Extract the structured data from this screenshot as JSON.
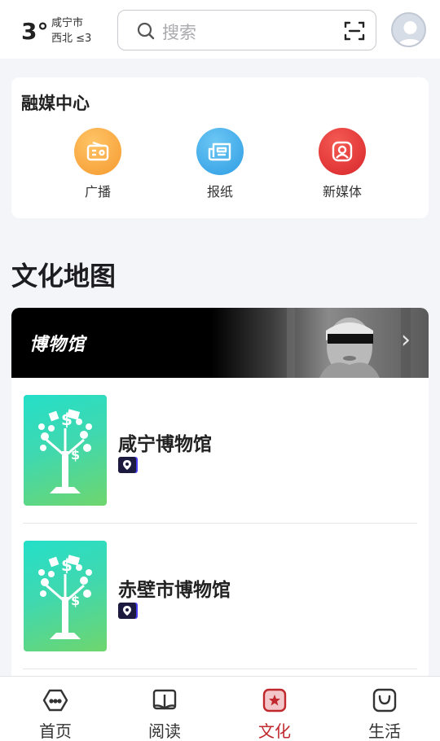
{
  "weather": {
    "temperature": "3°",
    "city": "咸宁市",
    "wind": "西北 ≤3"
  },
  "search": {
    "placeholder": "搜索"
  },
  "media_center": {
    "title": "融媒中心",
    "items": [
      {
        "label": "广播",
        "icon": "radio-icon",
        "color": "#f7a33a"
      },
      {
        "label": "报纸",
        "icon": "newspaper-icon",
        "color": "#3fa8ea"
      },
      {
        "label": "新媒体",
        "icon": "new-media-icon",
        "color": "#e33a3a"
      }
    ]
  },
  "culture_map": {
    "title": "文化地图",
    "banner_title": "博物馆",
    "museums": [
      {
        "name": "咸宁博物馆"
      },
      {
        "name": "赤壁市博物馆"
      }
    ]
  },
  "bottom_nav": {
    "items": [
      {
        "label": "首页",
        "icon": "home-icon",
        "active": false
      },
      {
        "label": "阅读",
        "icon": "book-icon",
        "active": false
      },
      {
        "label": "文化",
        "icon": "culture-star-icon",
        "active": true
      },
      {
        "label": "生活",
        "icon": "bag-icon",
        "active": false
      }
    ],
    "active_color": "#c0282d"
  }
}
